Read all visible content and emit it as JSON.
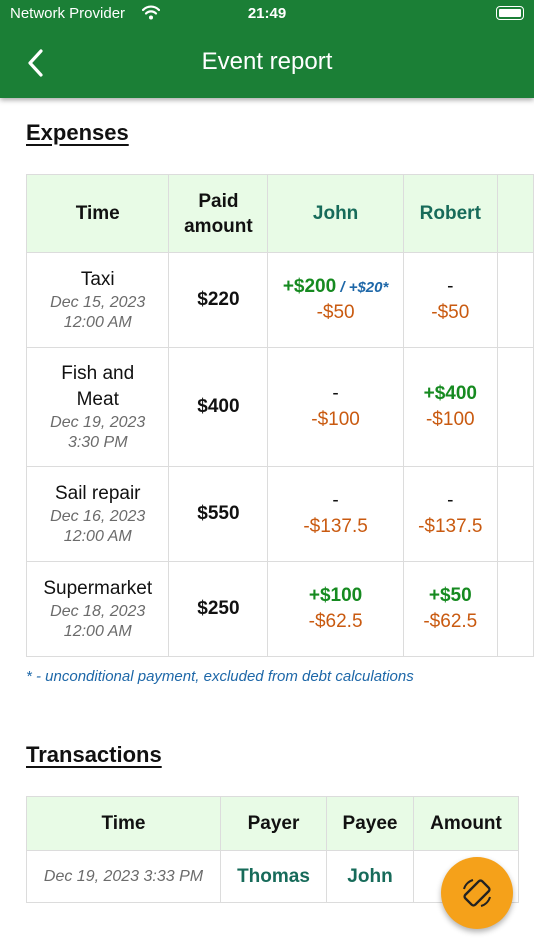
{
  "status_bar": {
    "carrier": "Network Provider",
    "time": "21:49"
  },
  "appbar": {
    "title": "Event report"
  },
  "expenses": {
    "heading": "Expenses",
    "columns": {
      "time": "Time",
      "paid": "Paid amount",
      "persons": [
        "John",
        "Robert"
      ]
    },
    "rows": [
      {
        "name": "Taxi",
        "date": "Dec 15, 2023",
        "time": "12:00 AM",
        "amount": "$220",
        "cells": [
          {
            "plus": "+$200",
            "extra": " / +$20*",
            "minus": "-$50"
          },
          {
            "plus": "-",
            "minus": "-$50"
          }
        ]
      },
      {
        "name": "Fish and Meat",
        "date": "Dec 19, 2023",
        "time": "3:30 PM",
        "amount": "$400",
        "cells": [
          {
            "plus": "-",
            "minus": "-$100"
          },
          {
            "plus": "+$400",
            "minus": "-$100"
          }
        ]
      },
      {
        "name": "Sail repair",
        "date": "Dec 16, 2023",
        "time": "12:00 AM",
        "amount": "$550",
        "cells": [
          {
            "plus": "-",
            "minus": "-$137.5"
          },
          {
            "plus": "-",
            "minus": "-$137.5"
          }
        ]
      },
      {
        "name": "Supermarket",
        "date": "Dec 18, 2023",
        "time": "12:00 AM",
        "amount": "$250",
        "cells": [
          {
            "plus": "+$100",
            "minus": "-$62.5"
          },
          {
            "plus": "+$50",
            "minus": "-$62.5"
          }
        ]
      }
    ],
    "footnote": "* - unconditional payment, excluded from debt calculations"
  },
  "transactions": {
    "heading": "Transactions",
    "columns": {
      "time": "Time",
      "payer": "Payer",
      "payee": "Payee",
      "amount": "Amount"
    },
    "rows": [
      {
        "time": "Dec 19, 2023 3:33 PM",
        "payer": "Thomas",
        "payee": "John",
        "amount": "$"
      }
    ]
  },
  "colors": {
    "appbar": "#1b7f36",
    "header_bg": "#e8fbe6",
    "positive": "#168a20",
    "negative": "#c95a10",
    "person": "#176b5a",
    "fab": "#f5a11a"
  },
  "icons": {
    "back": "chevron-left-icon",
    "fab": "screen-rotation-icon",
    "wifi": "wifi-icon",
    "battery": "battery-icon"
  }
}
